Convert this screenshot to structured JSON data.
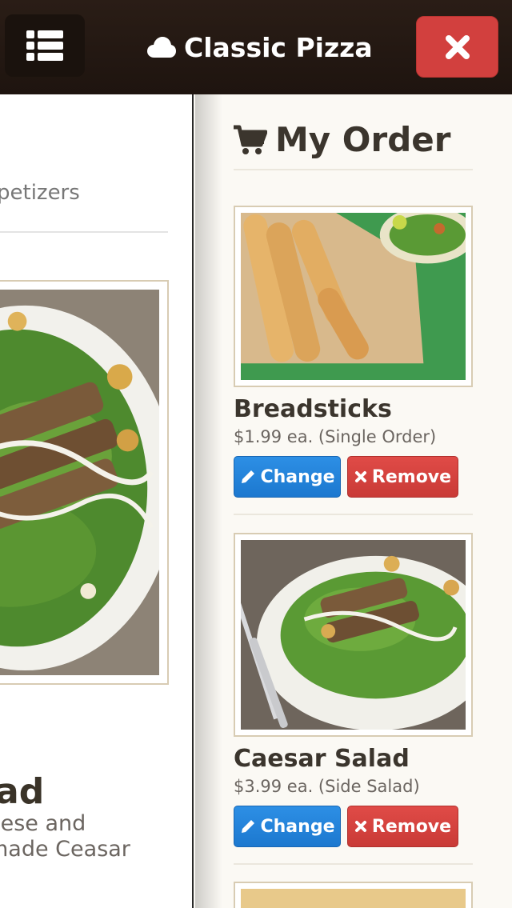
{
  "header": {
    "menu_icon": "list-icon",
    "brand_icon": "cloud-icon",
    "brand": "Classic Pizza",
    "close_icon": "close-icon"
  },
  "main": {
    "breadcrumb": "petizers",
    "title": "ad",
    "description": "eese and\nmade Ceasar"
  },
  "order": {
    "cart_icon": "cart-icon",
    "title": "My Order",
    "items": [
      {
        "name": "Breadsticks",
        "price": "$1.99 ea. (Single Order)",
        "change_label": "Change",
        "remove_label": "Remove"
      },
      {
        "name": "Caesar Salad",
        "price": "$3.99 ea. (Side Salad)",
        "change_label": "Change",
        "remove_label": "Remove"
      }
    ]
  },
  "colors": {
    "header_bg": "#1e140f",
    "close_red": "#d2403e",
    "change_blue": "#1c78cf",
    "remove_red": "#c93a36",
    "text_dark": "#3b352d"
  }
}
